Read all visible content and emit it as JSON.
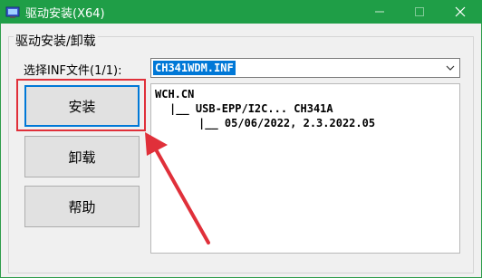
{
  "window": {
    "title": "驱动安装(X64)",
    "min_icon": "minimize-icon",
    "max_icon": "maximize-icon",
    "close_icon": "close-icon"
  },
  "group": {
    "label": "驱动安装/卸载"
  },
  "inf": {
    "label": "选择INF文件(1/1):",
    "selected": "CH341WDM.INF"
  },
  "buttons": {
    "install": "安装",
    "uninstall": "卸载",
    "help": "帮助"
  },
  "info": {
    "line1": "WCH.CN",
    "line2": "|__ USB-EPP/I2C... CH341A",
    "line3": "|__ 05/06/2022, 2.3.2022.05"
  },
  "annotation": {
    "highlight_color": "#e0303a"
  }
}
